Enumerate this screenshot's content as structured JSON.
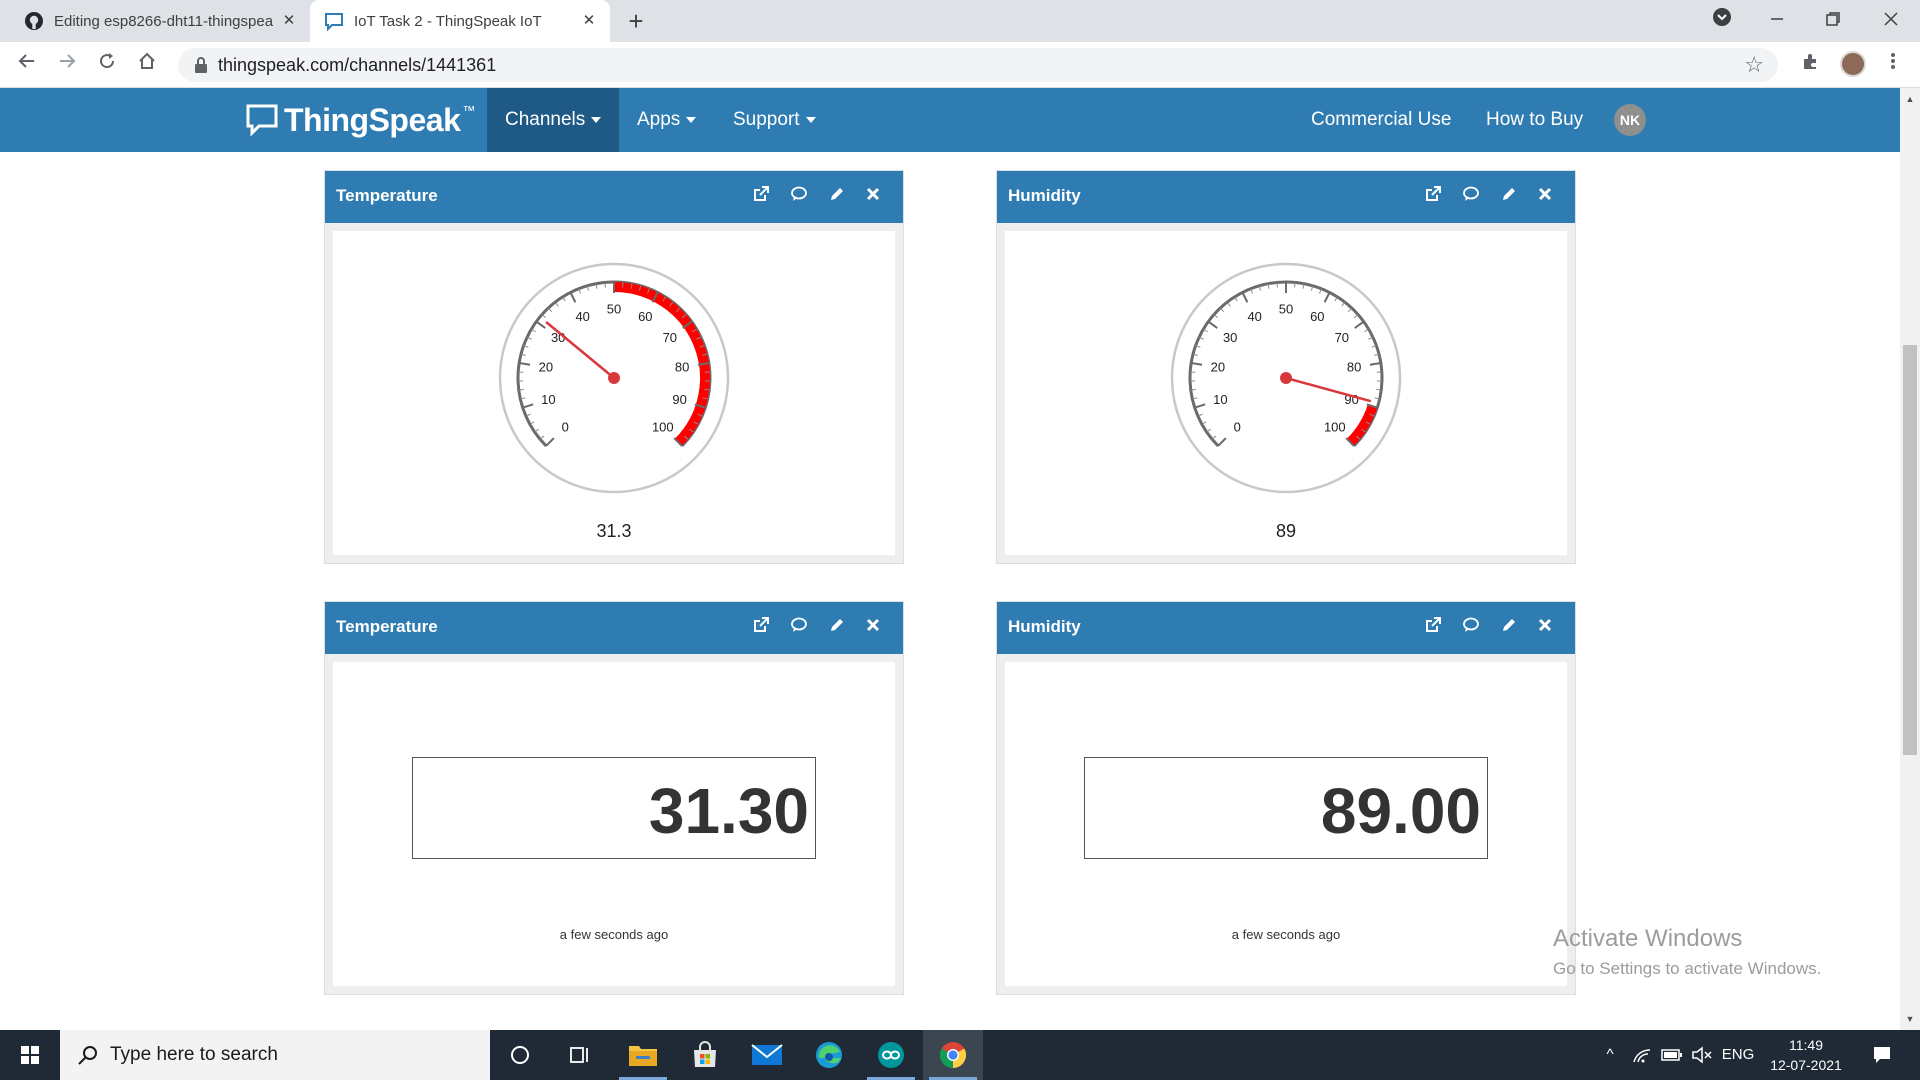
{
  "browser": {
    "tabs": [
      {
        "title": "Editing esp8266-dht11-thingspeak",
        "close": "✕"
      },
      {
        "title": "IoT Task 2 - ThingSpeak IoT",
        "close": "✕"
      }
    ],
    "new_tab": "+",
    "url": "thingspeak.com/channels/1441361"
  },
  "navbar": {
    "logo": "ThingSpeak",
    "logo_tm": "™",
    "items": [
      {
        "label": "Channels"
      },
      {
        "label": "Apps"
      },
      {
        "label": "Support"
      }
    ],
    "right_items": [
      {
        "label": "Commercial Use"
      },
      {
        "label": "How to Buy"
      }
    ],
    "avatar_initials": "NK"
  },
  "widgets": [
    {
      "title": "Temperature",
      "type": "gauge",
      "value": 31.3,
      "value_label": "31.3",
      "red_from": 50,
      "red_to": 100
    },
    {
      "title": "Humidity",
      "type": "gauge",
      "value": 89,
      "value_label": "89",
      "red_from": 90,
      "red_to": 100
    },
    {
      "title": "Temperature",
      "type": "numeric",
      "value_label": "31.30",
      "updated": "a few seconds ago"
    },
    {
      "title": "Humidity",
      "type": "numeric",
      "value_label": "89.00",
      "updated": "a few seconds ago"
    }
  ],
  "gauge_ticks": [
    "0",
    "10",
    "20",
    "30",
    "40",
    "50",
    "60",
    "70",
    "80",
    "90",
    "100"
  ],
  "watermark": {
    "title": "Activate Windows",
    "subtitle": "Go to Settings to activate Windows."
  },
  "taskbar": {
    "search_placeholder": "Type here to search",
    "language": "ENG",
    "time": "11:49",
    "date": "12-07-2021"
  },
  "colors": {
    "brand_blue": "#2f7cb2",
    "nav_active": "#1f5a86",
    "gauge_red": "#ff0000",
    "needle": "#d9383a"
  }
}
